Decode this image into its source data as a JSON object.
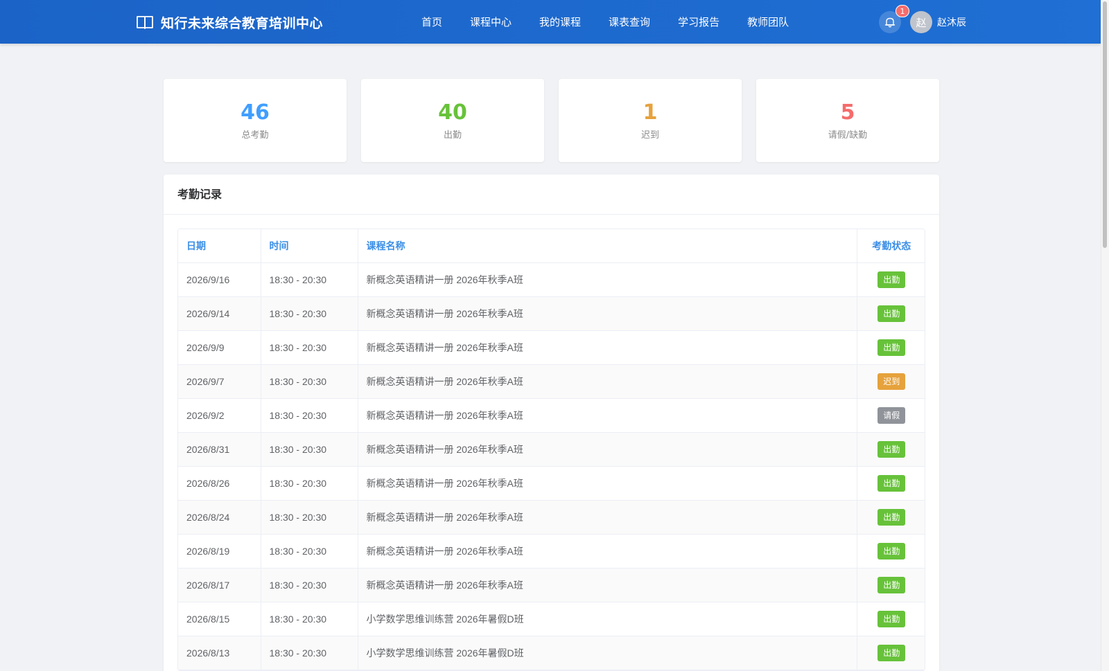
{
  "header": {
    "logo_text": "知行未来综合教育培训中心",
    "nav": [
      "首页",
      "课程中心",
      "我的课程",
      "课表查询",
      "学习报告",
      "教师团队"
    ],
    "notification_count": "1",
    "avatar_initial": "赵",
    "username": "赵沐辰",
    "colors": {
      "header_bg": "#1b63c7",
      "badge": "#f56c6c"
    }
  },
  "stats": [
    {
      "value": "46",
      "label": "总考勤",
      "color": "#409eff"
    },
    {
      "value": "40",
      "label": "出勤",
      "color": "#67c23a"
    },
    {
      "value": "1",
      "label": "迟到",
      "color": "#e6a23c"
    },
    {
      "value": "5",
      "label": "请假/缺勤",
      "color": "#f56c6c"
    }
  ],
  "attendance": {
    "title": "考勤记录",
    "columns": [
      "日期",
      "时间",
      "课程名称",
      "考勤状态"
    ],
    "status_colors": {
      "出勤": "#67c23a",
      "迟到": "#e6a23c",
      "请假": "#909399"
    },
    "rows": [
      {
        "date": "2026/9/16",
        "time": "18:30 - 20:30",
        "course": "新概念英语精讲一册 2026年秋季A班",
        "status": "出勤"
      },
      {
        "date": "2026/9/14",
        "time": "18:30 - 20:30",
        "course": "新概念英语精讲一册 2026年秋季A班",
        "status": "出勤"
      },
      {
        "date": "2026/9/9",
        "time": "18:30 - 20:30",
        "course": "新概念英语精讲一册 2026年秋季A班",
        "status": "出勤"
      },
      {
        "date": "2026/9/7",
        "time": "18:30 - 20:30",
        "course": "新概念英语精讲一册 2026年秋季A班",
        "status": "迟到"
      },
      {
        "date": "2026/9/2",
        "time": "18:30 - 20:30",
        "course": "新概念英语精讲一册 2026年秋季A班",
        "status": "请假"
      },
      {
        "date": "2026/8/31",
        "time": "18:30 - 20:30",
        "course": "新概念英语精讲一册 2026年秋季A班",
        "status": "出勤"
      },
      {
        "date": "2026/8/26",
        "time": "18:30 - 20:30",
        "course": "新概念英语精讲一册 2026年秋季A班",
        "status": "出勤"
      },
      {
        "date": "2026/8/24",
        "time": "18:30 - 20:30",
        "course": "新概念英语精讲一册 2026年秋季A班",
        "status": "出勤"
      },
      {
        "date": "2026/8/19",
        "time": "18:30 - 20:30",
        "course": "新概念英语精讲一册 2026年秋季A班",
        "status": "出勤"
      },
      {
        "date": "2026/8/17",
        "time": "18:30 - 20:30",
        "course": "新概念英语精讲一册 2026年秋季A班",
        "status": "出勤"
      },
      {
        "date": "2026/8/15",
        "time": "18:30 - 20:30",
        "course": "小学数学思维训练营 2026年暑假D班",
        "status": "出勤"
      },
      {
        "date": "2026/8/13",
        "time": "18:30 - 20:30",
        "course": "小学数学思维训练营 2026年暑假D班",
        "status": "出勤"
      }
    ]
  }
}
